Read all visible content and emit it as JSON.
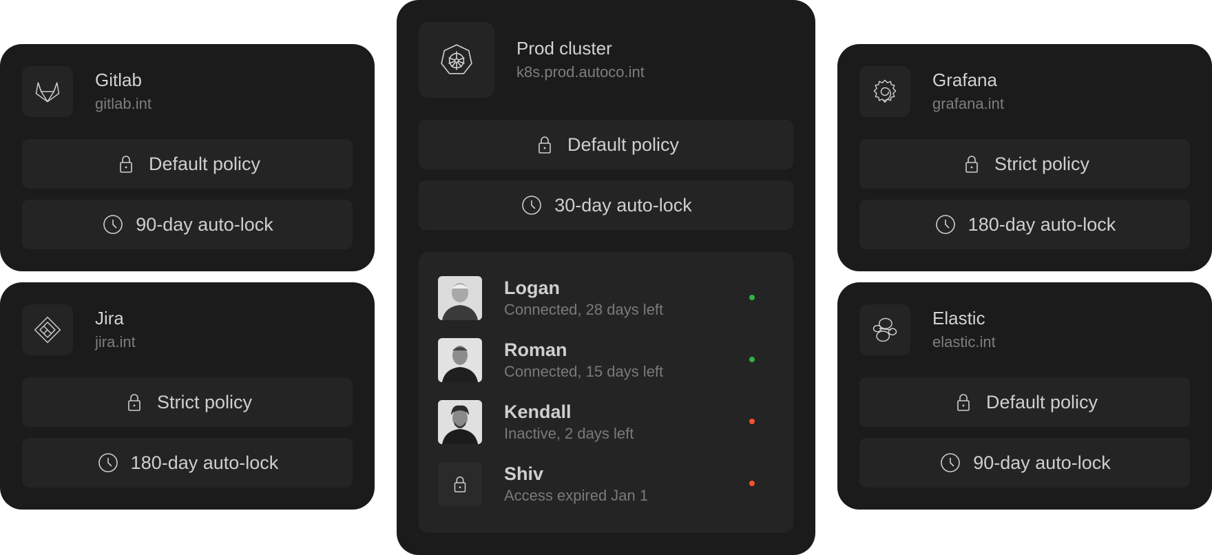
{
  "colors": {
    "page_bg": "#ffffff",
    "card_bg": "#1b1b1b",
    "pill_bg": "#242424",
    "status_connected": "#2fb344",
    "status_expiring": "#f2542d"
  },
  "cards": {
    "gitlab": {
      "name": "Gitlab",
      "host": "gitlab.int",
      "icon": "gitlab-icon",
      "policy": "Default policy",
      "autolock": "90-day auto-lock"
    },
    "jira": {
      "name": "Jira",
      "host": "jira.int",
      "icon": "jira-icon",
      "policy": "Strict policy",
      "autolock": "180-day auto-lock"
    },
    "grafana": {
      "name": "Grafana",
      "host": "grafana.int",
      "icon": "grafana-icon",
      "policy": "Strict policy",
      "autolock": "180-day auto-lock"
    },
    "elastic": {
      "name": "Elastic",
      "host": "elastic.int",
      "icon": "elastic-icon",
      "policy": "Default policy",
      "autolock": "90-day auto-lock"
    },
    "prod": {
      "name": "Prod cluster",
      "host": "k8s.prod.autoco.int",
      "icon": "kubernetes-icon",
      "policy": "Default policy",
      "autolock": "30-day auto-lock",
      "users": [
        {
          "name": "Logan",
          "status": "Connected, 28 days left",
          "state": "connected",
          "avatar": "user-photo"
        },
        {
          "name": "Roman",
          "status": "Connected, 15 days left",
          "state": "connected",
          "avatar": "user-photo"
        },
        {
          "name": "Kendall",
          "status": "Inactive, 2 days left",
          "state": "expiring",
          "avatar": "user-photo"
        },
        {
          "name": "Shiv",
          "status": "Access expired Jan 1",
          "state": "expiring",
          "avatar": "lock-icon"
        }
      ]
    }
  }
}
